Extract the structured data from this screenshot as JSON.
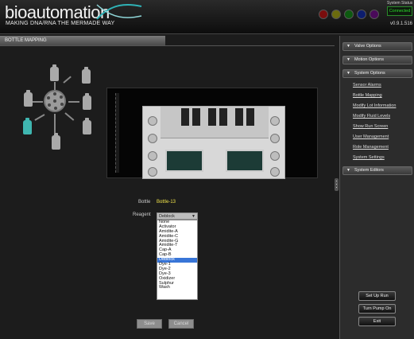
{
  "header": {
    "logo": "bioautomation",
    "tagline": "MAKING DNA/RNA THE MERMADE WAY",
    "status_title": "System Status",
    "status_value": "Connected",
    "version": "v0.9.1.516",
    "lights": [
      "#7a0d0d",
      "#6b6b0e",
      "#0d5a10",
      "#0c1d6e",
      "#4a0a5a"
    ]
  },
  "page": {
    "title": "BOTTLE MAPPING"
  },
  "form": {
    "bottle_label": "Bottle",
    "bottle_value": "Bottle-13",
    "reagent_label": "Reagent",
    "reagent_selected": "Deblock",
    "reagent_options": [
      "None",
      "Activator",
      "Amidite-A",
      "Amidite-C",
      "Amidite-G",
      "Amidite-T",
      "Cap-A",
      "Cap-B",
      "Deblock",
      "Dye-1",
      "Dye-2",
      "Dye-3",
      "Oxidizer",
      "Sulphur",
      "Wash"
    ],
    "save_label": "Save",
    "cancel_label": "Cancel"
  },
  "sidebar": {
    "sections": {
      "valve": "Valve Options",
      "motion": "Motion Options",
      "system": "System Options",
      "editors": "System Editors"
    },
    "system_items": [
      "Sensor Alarms",
      "Bottle Mapping",
      "Modify Lot Information",
      "Modify Fluid Levels",
      "Show Run Screen",
      "User Management",
      "Role Management",
      "System Settings"
    ],
    "buttons": {
      "setup_run": "Set Up Run",
      "turn_pump_on": "Turn Pump On",
      "exit": "Exit"
    }
  }
}
